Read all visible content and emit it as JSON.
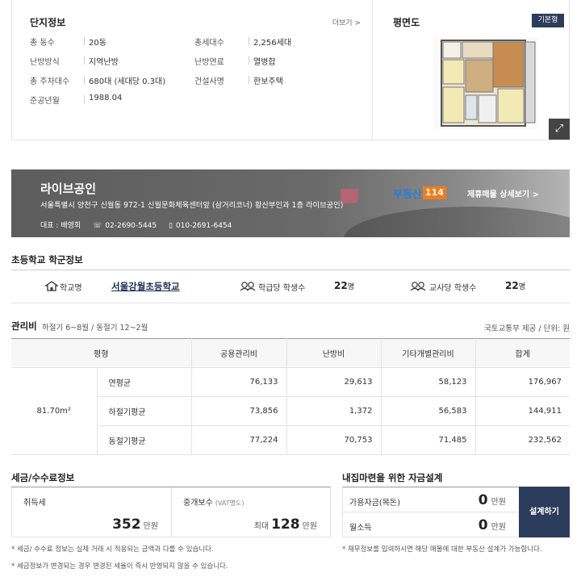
{
  "complex": {
    "title": "단지정보",
    "more": "더보기 >",
    "rows": [
      {
        "label": "총 동수",
        "value": "20동"
      },
      {
        "label": "총세대수",
        "value": "2,256세대"
      },
      {
        "label": "난방방식",
        "value": "지역난방"
      },
      {
        "label": "난방연료",
        "value": "열병합"
      },
      {
        "label": "총 주차대수",
        "value": "680대 (세대당 0.3대)"
      },
      {
        "label": "건설사명",
        "value": "한보주택"
      },
      {
        "label": "준공년월",
        "value": "1988.04"
      }
    ]
  },
  "floorplan": {
    "title": "평면도",
    "tag": "기본형",
    "expand_icon": "expand-icon"
  },
  "agent": {
    "name": "라이브공인",
    "address": "서울특별시 양천구 신월동 972-1 신월문화체육센터앞 (삼거리코너) 황산부인과 1층 라이브공인)",
    "rep": "대표 : 배영희",
    "phone1": "02-2690-5445",
    "phone2": "010-2691-6454",
    "brand_word": "부동산",
    "brand_num": "114",
    "link": "제휴매물 상세보기 >"
  },
  "school": {
    "title": "초등학교 학군정보",
    "name_label": "학교명",
    "name": "서울강월초등학교",
    "per_class_label": "학급당 학생수",
    "per_class": "22",
    "per_teacher_label": "교사당 학생수",
    "per_teacher": "22",
    "unit": "명"
  },
  "fees": {
    "title": "관리비",
    "subtitle": "하절기 6~8월 / 동절기 12~2월",
    "source": "국토교통부 제공 / 단위: 원",
    "headers": [
      "평형",
      "공용관리비",
      "난방비",
      "기타개별관리비",
      "합계"
    ],
    "area": "81.70m²",
    "rows": [
      {
        "label": "연평균",
        "values": [
          "76,133",
          "29,613",
          "58,123",
          "176,967"
        ]
      },
      {
        "label": "하절기평균",
        "values": [
          "73,856",
          "1,372",
          "56,583",
          "144,911"
        ]
      },
      {
        "label": "동절기평균",
        "values": [
          "77,224",
          "70,753",
          "71,485",
          "232,562"
        ]
      }
    ]
  },
  "tax": {
    "title": "세금/수수료정보",
    "acq_label": "취득세",
    "acq_value": "352",
    "unit": "만원",
    "fee_label": "중개보수",
    "fee_note": "(VAT별도)",
    "fee_prefix": "최대",
    "fee_value": "128",
    "note1": "* 세금/ 수수료 정보는 실제 거래 시 적용되는 금액과 다를 수 있습니다.",
    "note2": "* 세금정보가 변경되는 경우 변경된 세율이 즉시 반영되지 않을 수 있습니다."
  },
  "fund": {
    "title": "내집마련을 위한 자금설계",
    "row1_label": "가용자금(목돈)",
    "row1_value": "0",
    "row2_label": "월소득",
    "row2_value": "0",
    "unit": "만원",
    "button": "설계하기",
    "note": "* 재무정보를 입력하시면 해당 매물에 대한 부동산 설계가 가능합니다."
  },
  "colors": {
    "navy": "#2c3c5c",
    "brand_blue": "#2b7fd4",
    "brand_orange": "#f07c1e"
  }
}
